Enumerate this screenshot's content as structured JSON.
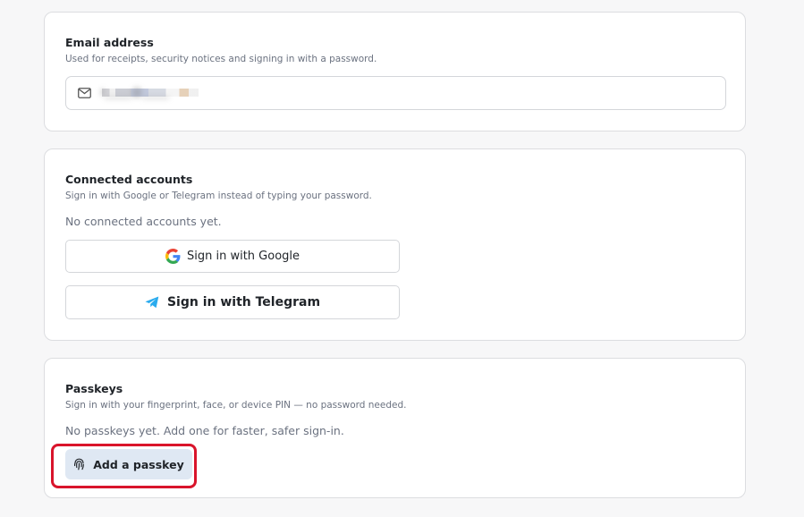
{
  "email_section": {
    "title": "Email address",
    "description": "Used for receipts, security notices and signing in with a password.",
    "email_value": "r_____@_____",
    "icon": "mail-icon"
  },
  "connected_section": {
    "title": "Connected accounts",
    "description": "Sign in with Google or Telegram instead of typing your password.",
    "empty_text": "No connected accounts yet.",
    "google_button": {
      "label": "Sign in with Google",
      "icon": "google-icon"
    },
    "telegram_button": {
      "label": "Sign in with Telegram",
      "icon": "telegram-icon",
      "color": "#2aabee"
    }
  },
  "passkeys_section": {
    "title": "Passkeys",
    "description": "Sign in with your fingerprint, face, or device PIN — no password needed.",
    "empty_text": "No passkeys yet. Add one for faster, safer sign-in.",
    "add_button": {
      "label": "Add a passkey",
      "icon": "fingerprint-icon"
    },
    "highlight_color": "#d9142b"
  }
}
